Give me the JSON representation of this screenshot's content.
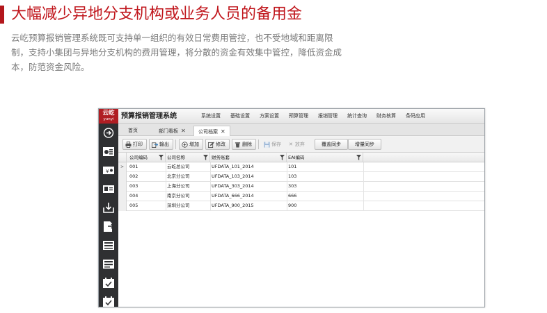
{
  "slide": {
    "title": "大幅减少异地分支机构或业务人员的备用金",
    "description": "云屹预算报销管理系统既可支持单一组织的有效日常费用管控，也不受地域和距离限制，支持小集团与异地分支机构的费用管理，将分散的资金有效集中管控，降低资金成本，防范资金风险。"
  },
  "app": {
    "logo_main": "云屹",
    "logo_sub": "yunyi",
    "title": "预算报销管理系统",
    "menu": [
      "系统设置",
      "基础设置",
      "方案设置",
      "预算管理",
      "报销管理",
      "统计查询",
      "财务核算",
      "条码应用"
    ],
    "tabs": [
      {
        "label": "首页",
        "closable": false
      },
      {
        "label": "部门看板",
        "closable": true
      },
      {
        "label": "公司档案",
        "closable": true,
        "active": true
      }
    ],
    "toolbar": {
      "print": "打印",
      "export": "输出",
      "add": "增加",
      "edit": "修改",
      "delete": "删除",
      "save": "保存",
      "discard": "放弃",
      "overwrite_sync": "覆盖同步",
      "incremental_sync": "增量同步"
    },
    "grid": {
      "columns": [
        "公司编码",
        "公司名称",
        "财务账套",
        "EAI编码"
      ],
      "rows": [
        [
          "001",
          "云屹总公司",
          "UFDATA_101_2014",
          "101"
        ],
        [
          "002",
          "北京分公司",
          "UFDATA_103_2014",
          "103"
        ],
        [
          "003",
          "上海分公司",
          "UFDATA_303_2014",
          "303"
        ],
        [
          "004",
          "南京分公司",
          "UFDATA_666_2014",
          "666"
        ],
        [
          "005",
          "深圳分公司",
          "UFDATA_900_2015",
          "900"
        ]
      ],
      "current_row_marker": ">"
    },
    "colors": {
      "brand_red": "#b01e23",
      "title_red": "#c0161c",
      "sidebar": "#2f3032"
    }
  }
}
